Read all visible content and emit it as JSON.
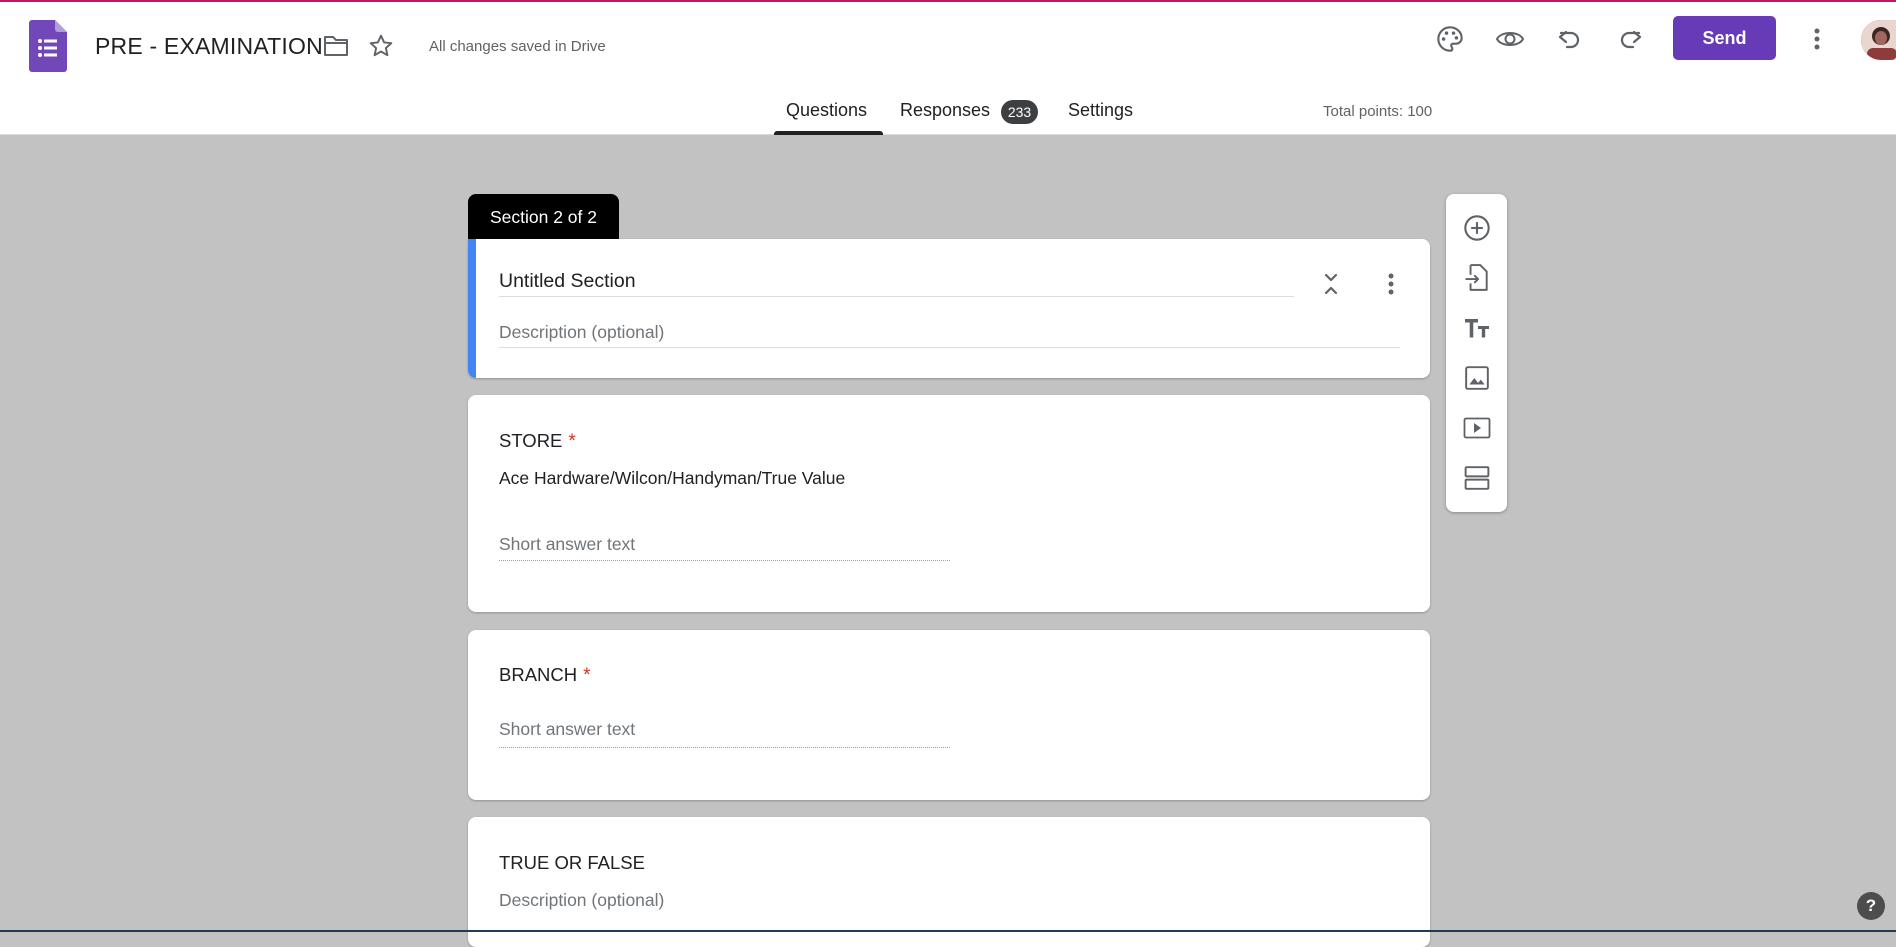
{
  "header": {
    "doc_title": "PRE - EXAMINATION",
    "save_status": "All changes saved in Drive",
    "send_label": "Send",
    "icons": [
      "forms-logo-icon",
      "folder-icon",
      "star-icon",
      "palette-icon",
      "preview-eye-icon",
      "undo-icon",
      "redo-icon",
      "more-vert-icon",
      "avatar"
    ]
  },
  "tabs": {
    "questions": "Questions",
    "responses": "Responses",
    "responses_count": "233",
    "settings": "Settings",
    "active": "Questions"
  },
  "total_points": "Total points: 100",
  "section": {
    "label": "Section 2 of 2",
    "title": "Untitled Section",
    "description_placeholder": "Description (optional)"
  },
  "questions": [
    {
      "title": "STORE",
      "required_mark": "*",
      "description": "Ace Hardware/Wilcon/Handyman/True Value",
      "answer_placeholder": "Short answer text"
    },
    {
      "title": "BRANCH",
      "required_mark": "*",
      "answer_placeholder": "Short answer text"
    },
    {
      "title": "TRUE OR FALSE",
      "description_placeholder": "Description (optional)"
    }
  ],
  "side_toolbar": [
    "add-question-icon",
    "import-questions-icon",
    "add-title-icon",
    "add-image-icon",
    "add-video-icon",
    "add-section-icon"
  ],
  "help_label": "?",
  "colors": {
    "accent": "#673ab7",
    "section_accent": "#4285f4",
    "background": "#c2c2c2",
    "required": "#d93025"
  }
}
